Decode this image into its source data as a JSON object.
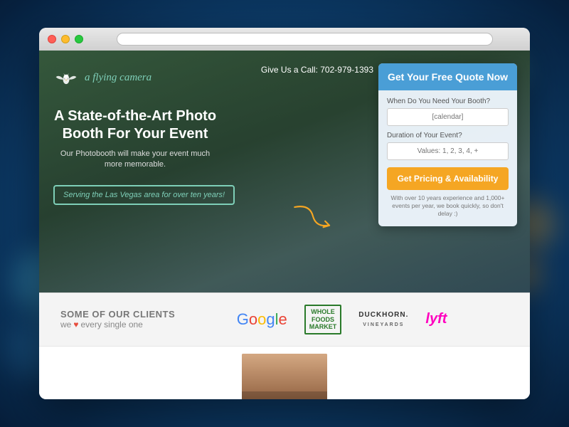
{
  "window": {
    "traffic_lights": [
      "red",
      "yellow",
      "green"
    ]
  },
  "hero": {
    "logo_text": "a flying camera",
    "phone_label": "Give Us a Call: 702-979-1393",
    "headline": "A State-of-the-Art Photo Booth For Your Event",
    "subtext": "Our Photobooth will make your event much more memorable.",
    "serving_badge": "Serving the Las Vegas area for over ten years!"
  },
  "quote_form": {
    "header": "Get Your Free Quote Now",
    "date_label": "When Do You Need Your Booth?",
    "date_placeholder": "[calendar]",
    "duration_label": "Duration of Your Event?",
    "duration_placeholder": "Values: 1, 2, 3, 4, +",
    "cta_button": "Get Pricing & Availability",
    "disclaimer": "With over 10 years experience and 1,000+ events per year, we book quickly, so don't delay :)"
  },
  "clients": {
    "title": "SOME OF OUR CLIENTS",
    "subtitle": "we",
    "subtitle_end": "every single one",
    "logos": [
      "Google",
      "Whole Foods Market",
      "Duckhorn Vineyards",
      "lyft"
    ]
  }
}
